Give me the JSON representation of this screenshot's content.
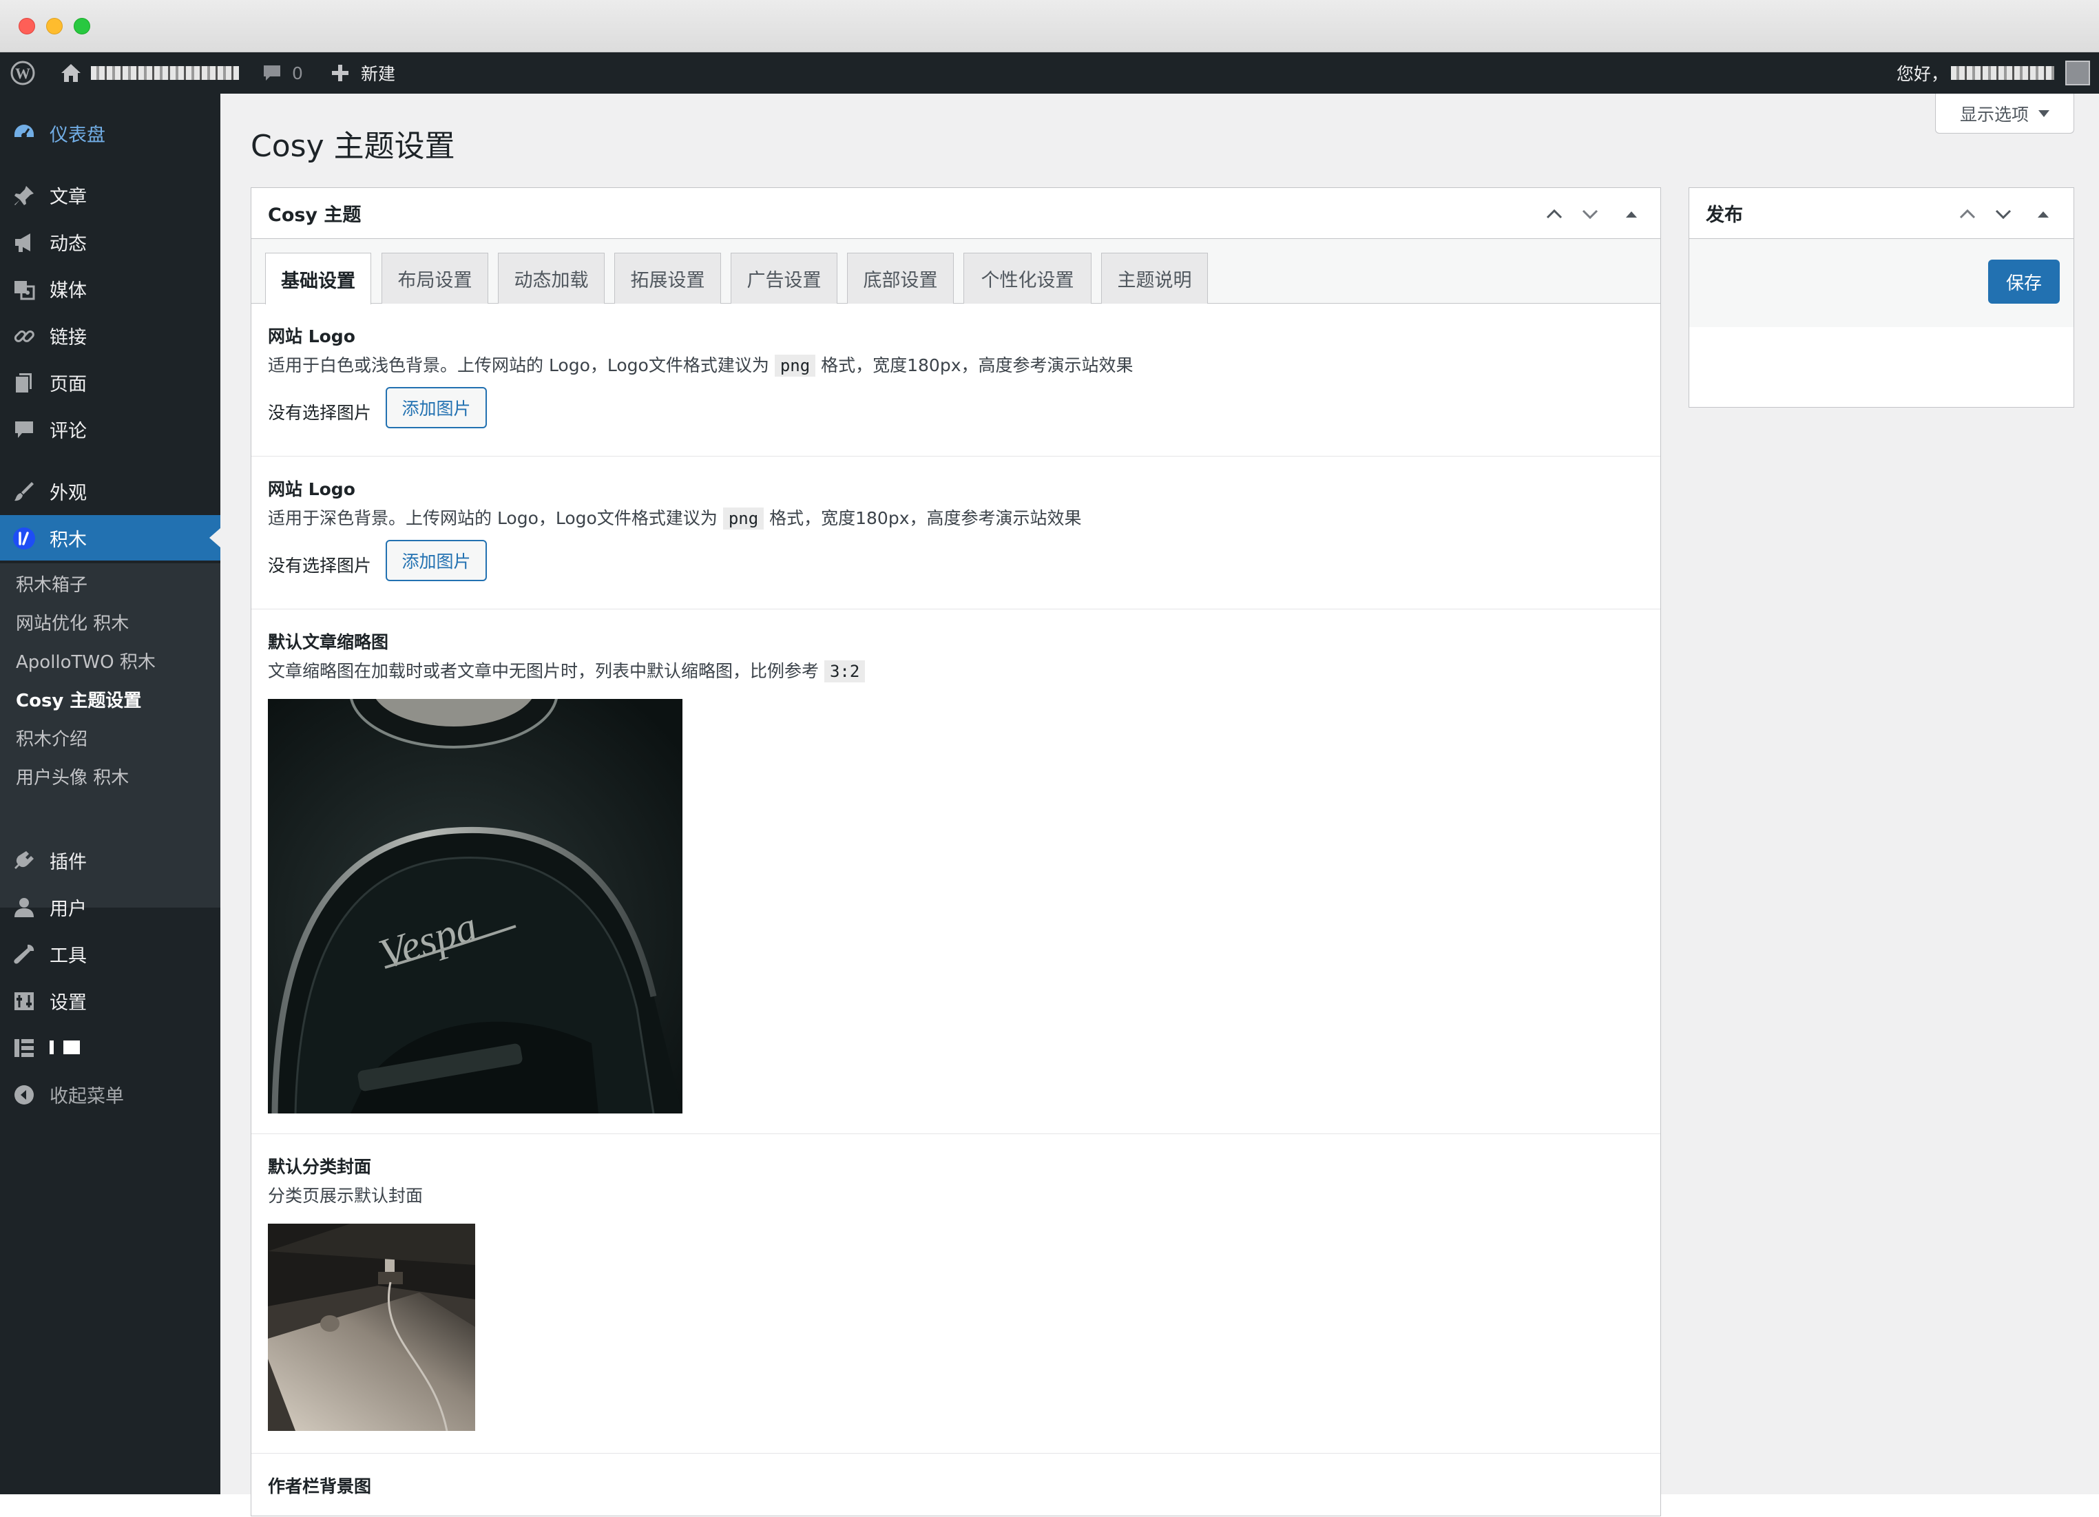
{
  "adminbar": {
    "comments_count": "0",
    "new_label": "新建",
    "greeting": "您好，"
  },
  "sidebar": {
    "dashboard": "仪表盘",
    "posts": "文章",
    "activity": "动态",
    "media": "媒体",
    "links": "链接",
    "pages": "页面",
    "comments": "评论",
    "appearance": "外观",
    "jimu": "积木",
    "submenu": [
      "积木箱子",
      "网站优化 积木",
      "ApolloTWO 积木",
      "Cosy 主题设置",
      "积木介绍",
      "用户头像 积木"
    ],
    "plugins": "插件",
    "users": "用户",
    "tools": "工具",
    "settings": "设置",
    "collapse": "收起菜单"
  },
  "page": {
    "title": "Cosy 主题设置",
    "screen_options": "显示选项"
  },
  "theme_box": {
    "title": "Cosy 主题",
    "tabs": [
      "基础设置",
      "布局设置",
      "动态加载",
      "拓展设置",
      "广告设置",
      "底部设置",
      "个性化设置",
      "主题说明"
    ],
    "sections": [
      {
        "title": "网站 Logo",
        "desc_before": "适用于白色或浅色背景。上传网站的 Logo，Logo文件格式建议为",
        "code": "png",
        "desc_after": "格式，宽度180px，高度参考演示站效果",
        "no_image": "没有选择图片",
        "button": "添加图片"
      },
      {
        "title": "网站 Logo",
        "desc_before": "适用于深色背景。上传网站的 Logo，Logo文件格式建议为",
        "code": "png",
        "desc_after": "格式，宽度180px，高度参考演示站效果",
        "no_image": "没有选择图片",
        "button": "添加图片"
      },
      {
        "title": "默认文章缩略图",
        "desc_before": "文章缩略图在加载时或者文章中无图片时，列表中默认缩略图，比例参考",
        "code": "3:2"
      },
      {
        "title": "默认分类封面",
        "desc_before": "分类页展示默认封面"
      },
      {
        "title": "作者栏背景图"
      }
    ]
  },
  "publish_box": {
    "title": "发布",
    "save": "保存"
  }
}
